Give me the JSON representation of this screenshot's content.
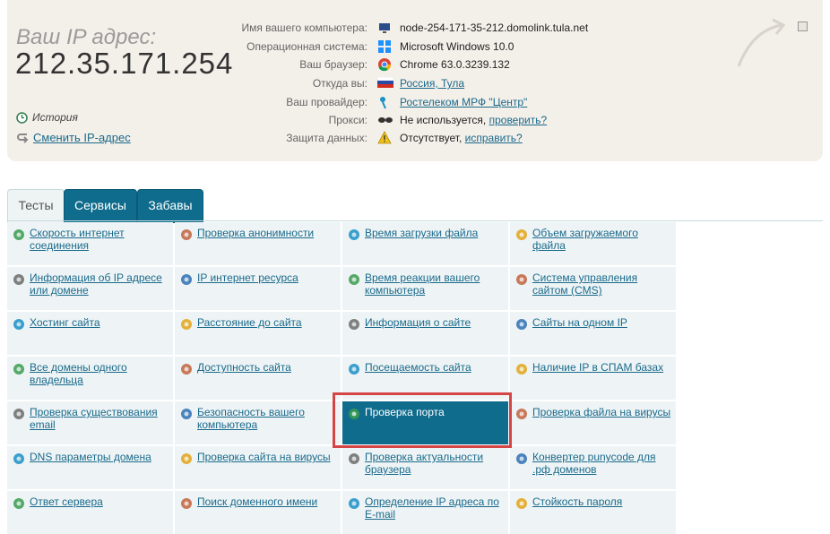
{
  "header": {
    "ip_label": "Ваш IP адрес:",
    "ip_value": "212.35.171.254",
    "history_label": "История",
    "change_ip_label": "Сменить IP-адрес"
  },
  "info": [
    {
      "label": "Имя вашего компьютера:",
      "value": "node-254-171-35-212.domolink.tula.net",
      "icon": "computer-icon"
    },
    {
      "label": "Операционная система:",
      "value": "Microsoft Windows 10.0",
      "icon": "windows-icon"
    },
    {
      "label": "Ваш браузер:",
      "value": "Chrome 63.0.3239.132",
      "icon": "chrome-icon"
    },
    {
      "label": "Откуда вы:",
      "value": "Россия, Тула",
      "icon": "russia-flag-icon"
    },
    {
      "label": "Ваш провайдер:",
      "value": "Ростелеком МРФ \"Центр\"",
      "icon": "provider-icon"
    },
    {
      "label": "Прокси:",
      "value": "Не используется,",
      "link": "проверить?",
      "icon": "glasses-icon"
    },
    {
      "label": "Защита данных:",
      "value": "Отсутствует,",
      "link": "исправить?",
      "icon": "warning-icon"
    }
  ],
  "tabs": [
    "Тесты",
    "Сервисы",
    "Забавы"
  ],
  "grid": [
    [
      "Скорость интернет соединения",
      "Проверка анонимности",
      "Время загрузки файла",
      "Объем загружаемого файла"
    ],
    [
      "Информация об IP адресе или домене",
      "IP интернет ресурса",
      "Время реакции вашего компьютера",
      "Система управления сайтом (CMS)"
    ],
    [
      "Хостинг сайта",
      "Расстояние до сайта",
      "Информация о сайте",
      "Сайты на одном IP"
    ],
    [
      "Все домены одного владельца",
      "Доступность сайта",
      "Посещаемость сайта",
      "Наличие IP в СПАМ базах"
    ],
    [
      "Проверка существования email",
      "Безопасность вашего компьютера",
      "Проверка порта",
      "Проверка файла на вирусы"
    ],
    [
      "DNS параметры домена",
      "Проверка сайта на вирусы",
      "Проверка актуальности браузера",
      "Конвертер punycode для .рф доменов"
    ],
    [
      "Ответ сервера",
      "Поиск доменного имени",
      "Определение IP адреса по E-mail",
      "Стойкость пароля"
    ]
  ],
  "icons": [
    [
      "speed-icon",
      "anonymity-icon",
      "clock-icon",
      "file-size-icon"
    ],
    [
      "ip-icon",
      "ip-resource-icon",
      "reaction-icon",
      "cms-icon"
    ],
    [
      "hosting-icon",
      "location-pin-icon",
      "info-document-icon",
      "sites-ip-icon"
    ],
    [
      "domains-icon",
      "globe-icon",
      "star-icon",
      "spam-icon"
    ],
    [
      "email-icon",
      "lock-icon",
      "port-icon",
      "virus-file-icon"
    ],
    [
      "dns-icon",
      "site-virus-icon",
      "browser-icon",
      "punycode-icon"
    ],
    [
      "server-icon",
      "domain-search-icon",
      "email-ip-icon",
      "password-icon"
    ]
  ]
}
